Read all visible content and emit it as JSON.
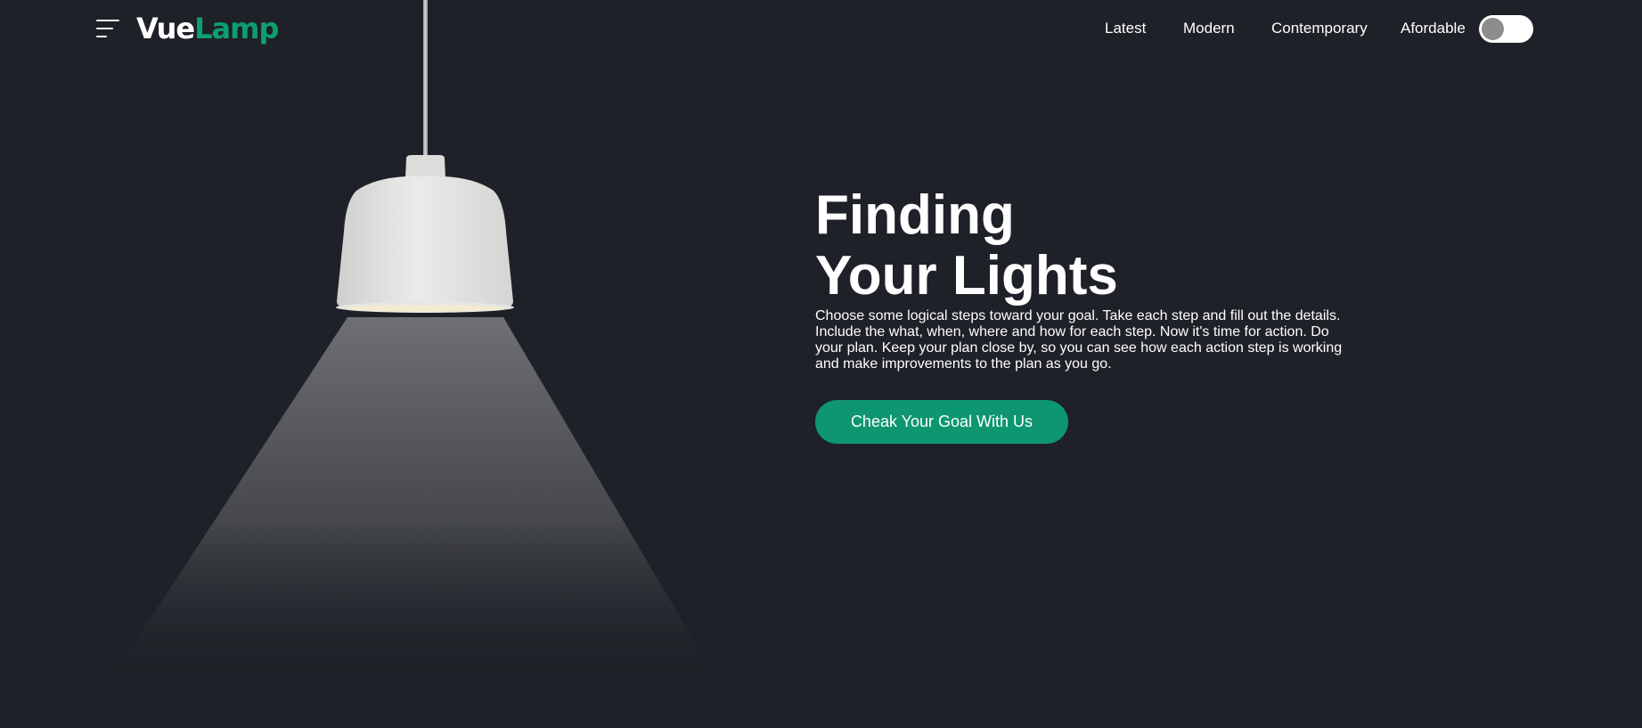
{
  "header": {
    "logo": {
      "part1": "Vue",
      "part2": "Lamp"
    },
    "nav": [
      {
        "label": "Latest"
      },
      {
        "label": "Modern"
      },
      {
        "label": "Contemporary"
      },
      {
        "label": "Afordable"
      }
    ],
    "theme_toggle": {
      "state": "off"
    }
  },
  "hero": {
    "title_line1": "Finding",
    "title_line2": "Your Lights",
    "description": "Choose some logical steps toward your goal. Take each step and fill out the details. Include the what, when, where and how for each step. Now it's time for action. Do your plan. Keep your plan close by, so you can see how each action step is working and make improvements to the plan as you go.",
    "cta_label": "Cheak Your Goal With Us"
  },
  "icons": [
    "menu-icon",
    "toggle-switch",
    "pendant-lamp"
  ],
  "colors": {
    "background": "#1f2128",
    "accent": "#0e9f6e",
    "button": "#0e9671",
    "text": "#ffffff"
  }
}
